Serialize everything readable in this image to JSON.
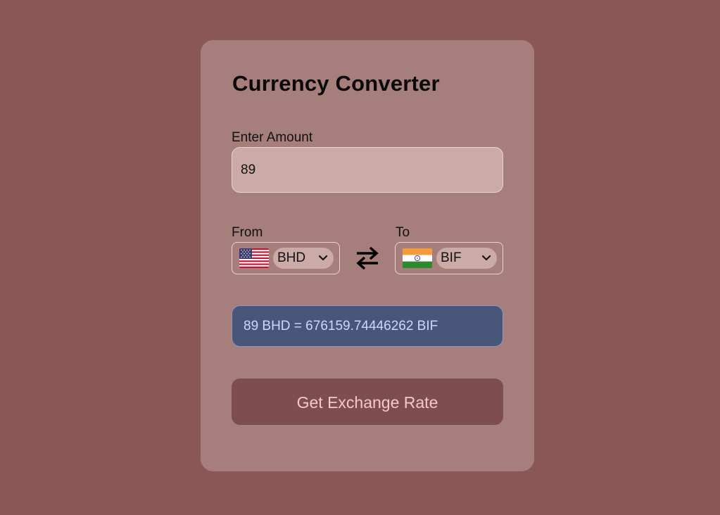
{
  "app": {
    "title": "Currency Converter"
  },
  "amount": {
    "label": "Enter Amount",
    "value": "89"
  },
  "from": {
    "label": "From",
    "currency": "BHD",
    "flag_icon": "us-flag-icon"
  },
  "to": {
    "label": "To",
    "currency": "BIF",
    "flag_icon": "india-flag-icon"
  },
  "result": {
    "text": "89 BHD = 676159.74446262 BIF"
  },
  "button": {
    "label": "Get Exchange Rate"
  },
  "colors": {
    "page_background": "#8b5656",
    "card_background": "#a67e7c",
    "result_background": "#48567a",
    "button_background": "#7e4e4e"
  }
}
